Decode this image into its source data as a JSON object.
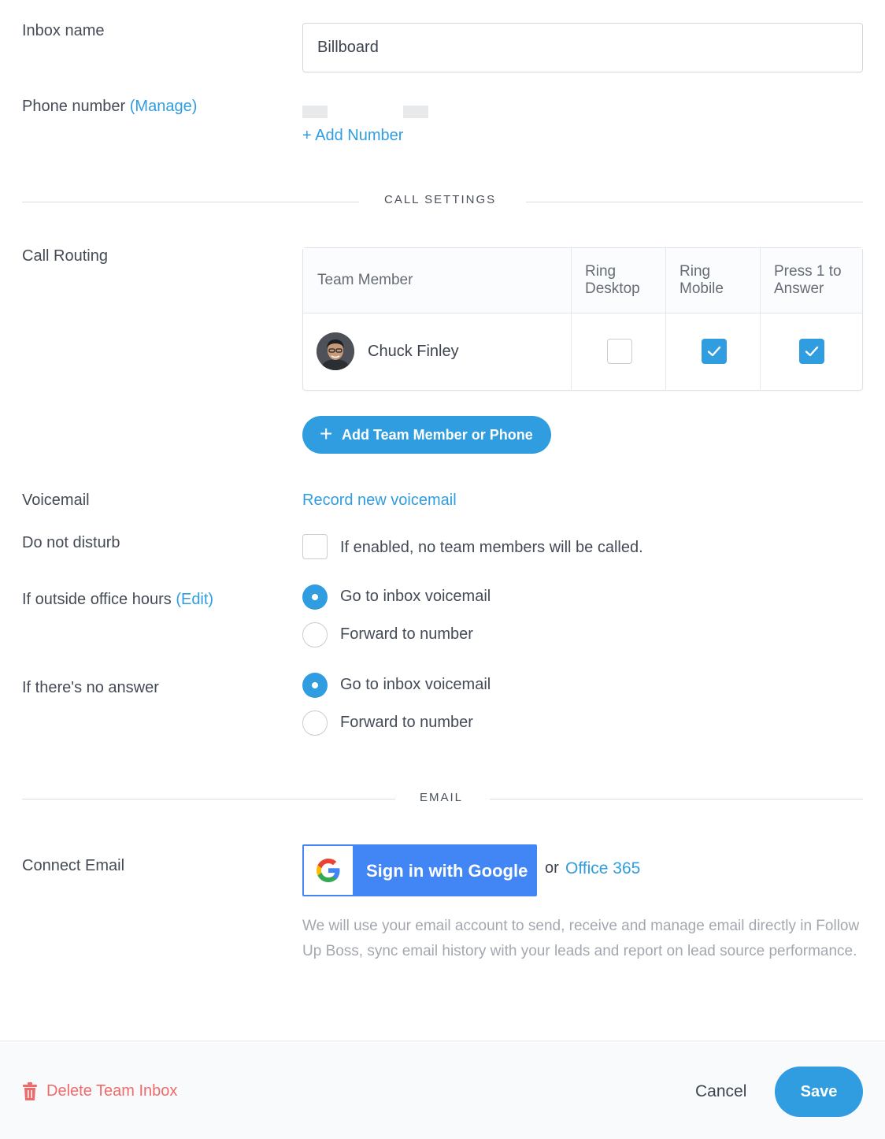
{
  "fields": {
    "inbox_name_label": "Inbox name",
    "inbox_name_value": "Billboard",
    "phone_label": "Phone number",
    "phone_manage": "(Manage)",
    "add_number": "+ Add Number"
  },
  "call_settings": {
    "title": "CALL SETTINGS",
    "routing_label": "Call Routing",
    "table": {
      "headers": [
        "Team Member",
        "Ring Desktop",
        "Ring Mobile",
        "Press 1 to Answer"
      ],
      "rows": [
        {
          "name": "Chuck Finley",
          "ring_desktop": false,
          "ring_mobile": true,
          "press1": true
        }
      ]
    },
    "add_member_button": "Add Team Member or Phone",
    "voicemail_label": "Voicemail",
    "voicemail_link": "Record new voicemail",
    "dnd_label": "Do not disturb",
    "dnd_text": "If enabled, no team members will be called.",
    "outside_hours_label": "If outside office hours",
    "outside_hours_edit": "(Edit)",
    "no_answer_label": "If there's no answer",
    "option_voicemail": "Go to inbox voicemail",
    "option_forward": "Forward to number"
  },
  "email": {
    "title": "EMAIL",
    "connect_label": "Connect Email",
    "google_button": "Sign in with Google",
    "or_text": "or",
    "office_link": "Office 365",
    "description": "We will use your email account to send, receive and manage email directly in Follow Up Boss, sync email history with your leads and report on lead source performance."
  },
  "footer": {
    "delete": "Delete Team Inbox",
    "cancel": "Cancel",
    "save": "Save"
  },
  "colors": {
    "accent": "#2f9ddf",
    "danger": "#ef6b6b",
    "google_blue": "#4285f4"
  }
}
